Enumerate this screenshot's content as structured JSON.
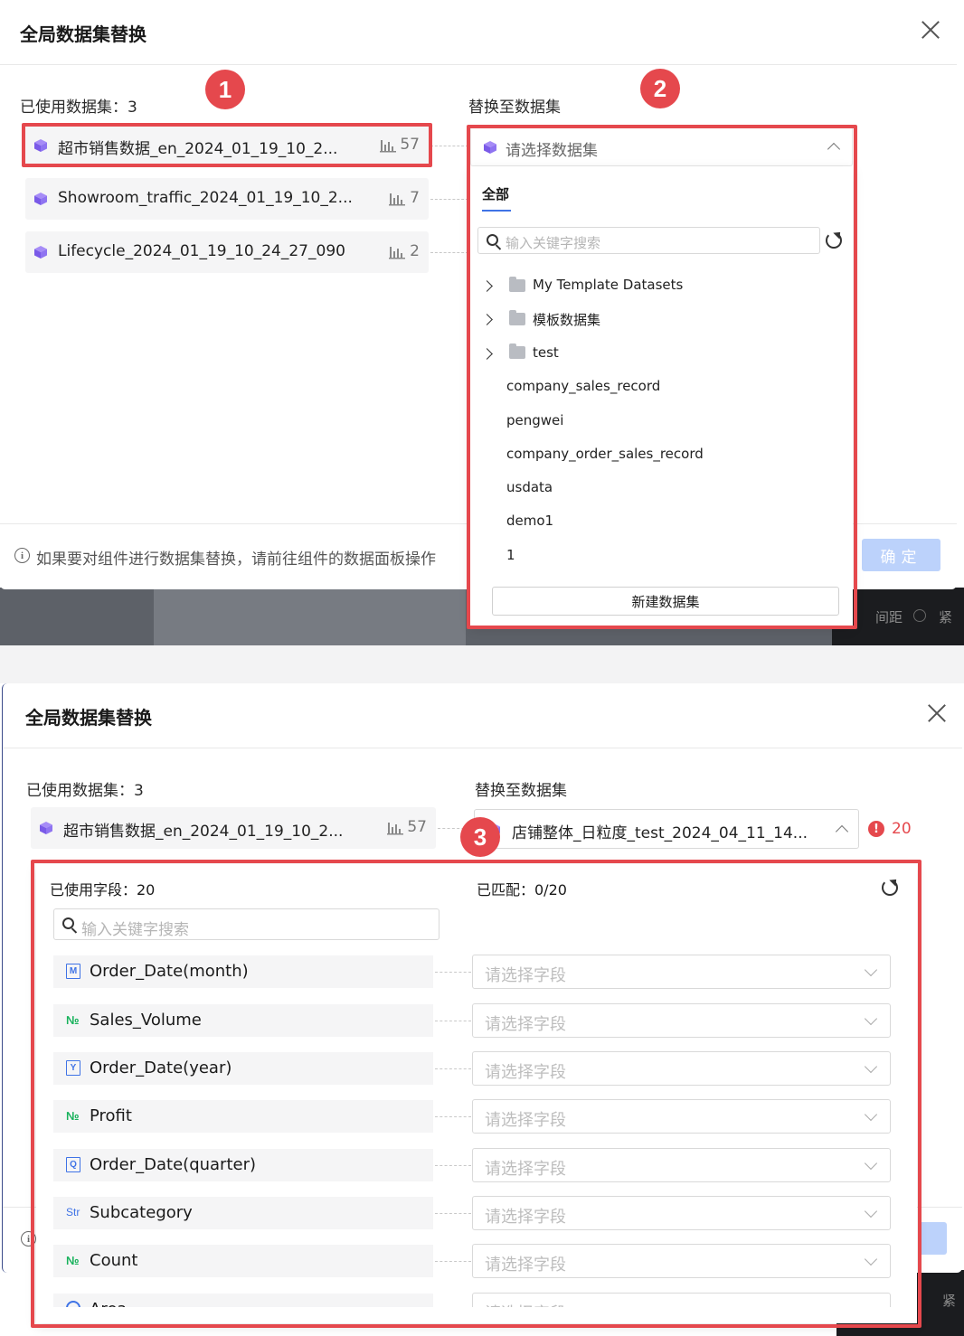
{
  "top": {
    "title": "全局数据集替换",
    "used_label": "已使用数据集：3",
    "replace_label": "替换至数据集",
    "datasets": [
      {
        "name": "超市销售数据_en_2024_01_19_10_2...",
        "count": "57"
      },
      {
        "name": "Showroom_traffic_2024_01_19_10_2...",
        "count": "7"
      },
      {
        "name": "Lifecycle_2024_01_19_10_24_27_090",
        "count": "2"
      }
    ],
    "select_placeholder": "请选择数据集",
    "dropdown": {
      "tab_all": "全部",
      "search_placeholder": "输入关键字搜索",
      "folders": [
        "My Template Datasets",
        "模板数据集",
        "test"
      ],
      "items": [
        "company_sales_record",
        "pengwei",
        "company_order_sales_record",
        "usdata",
        "demo1",
        "1"
      ],
      "new_button": "新建数据集"
    },
    "footer_tip": "如果要对组件进行数据集替换，请前往组件的数据面板操作",
    "confirm": "确定",
    "bg_text_1": "间距",
    "bg_text_2": "紧"
  },
  "badges": [
    "1",
    "2",
    "3"
  ],
  "bottom": {
    "title": "全局数据集替换",
    "used_label": "已使用数据集：3",
    "replace_label": "替换至数据集",
    "dataset": {
      "name": "超市销售数据_en_2024_01_19_10_2...",
      "count": "57"
    },
    "selected_dataset": "店铺整体_日粒度_test_2024_04_11_14...",
    "warning_count": "20",
    "used_fields_label": "已使用字段：20",
    "matched_label": "已匹配：0/20",
    "search_placeholder": "输入关键字搜索",
    "field_placeholder": "请选择字段",
    "fields": [
      {
        "name": "Order_Date(month)",
        "type_icon": "M"
      },
      {
        "name": "Sales_Volume",
        "type_icon": "№"
      },
      {
        "name": "Order_Date(year)",
        "type_icon": "Y"
      },
      {
        "name": "Profit",
        "type_icon": "№"
      },
      {
        "name": "Order_Date(quarter)",
        "type_icon": "Q"
      },
      {
        "name": "Subcategory",
        "type_icon": "Str"
      },
      {
        "name": "Count",
        "type_icon": "№"
      },
      {
        "name": "Area",
        "type_icon": "geo"
      }
    ],
    "bg_text": "紧"
  },
  "colors": {
    "accent": "#3f73e6",
    "annotation_red": "#e5484d",
    "dataset_icon": "#8b6cf2",
    "number_green": "#18b25c"
  }
}
